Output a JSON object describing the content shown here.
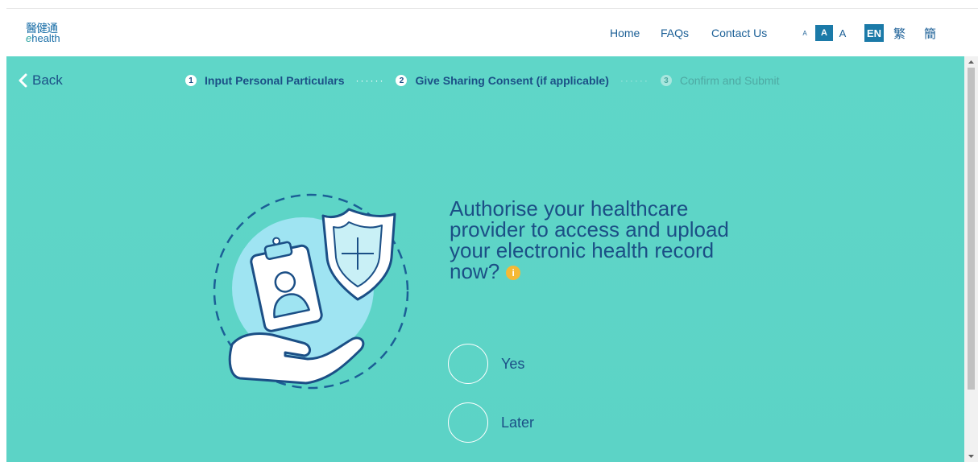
{
  "logo": {
    "chinese": "醫健通",
    "english_prefix": "e",
    "english_rest": "health"
  },
  "nav": {
    "home": "Home",
    "faqs": "FAQs",
    "contact": "Contact Us"
  },
  "font_size": {
    "small": "A",
    "medium": "A",
    "large": "A"
  },
  "language": {
    "en": "EN",
    "tc": "繁",
    "sc": "簡"
  },
  "back_label": "Back",
  "steps": [
    {
      "num": "1",
      "label": "Input Personal Particulars",
      "state": "done"
    },
    {
      "num": "2",
      "label": "Give Sharing Consent (if applicable)",
      "state": "active"
    },
    {
      "num": "3",
      "label": "Confirm and Submit",
      "state": "pending"
    }
  ],
  "step_separator": "······",
  "question": "Authorise your healthcare provider to access and upload your electronic health record now?",
  "info_icon": "i",
  "options": {
    "yes": "Yes",
    "later": "Later"
  },
  "colors": {
    "teal_bg": "#5cd3c6",
    "navy_text": "#1b4f86",
    "accent_blue": "#1b7aa8",
    "info_orange": "#f5b935"
  }
}
